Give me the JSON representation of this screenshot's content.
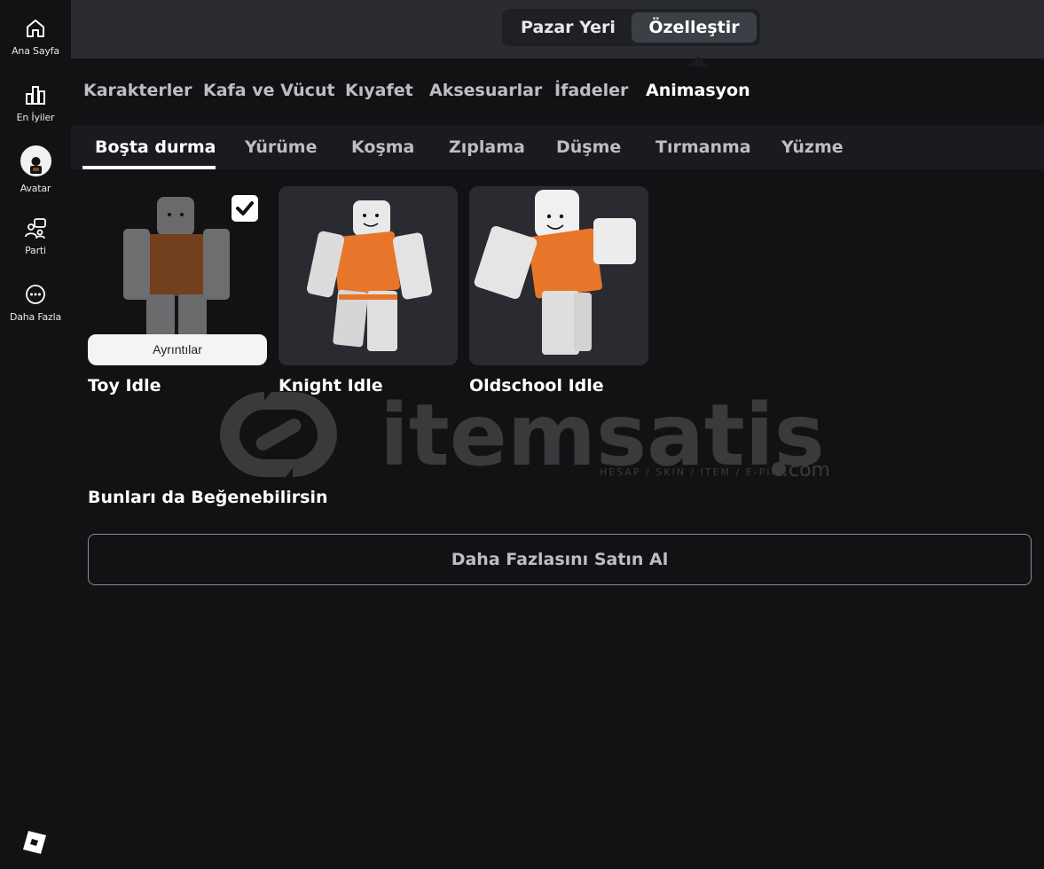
{
  "sidebar": {
    "items": [
      {
        "label": "Ana Sayfa",
        "icon": "home-icon"
      },
      {
        "label": "En İyiler",
        "icon": "chart-icon"
      },
      {
        "label": "Avatar",
        "icon": "avatar-icon"
      },
      {
        "label": "Parti",
        "icon": "party-icon"
      },
      {
        "label": "Daha Fazla",
        "icon": "more-icon"
      }
    ],
    "logo": "roblox-logo-icon"
  },
  "topbar": {
    "tabs": [
      {
        "label": "Pazar Yeri",
        "active": false
      },
      {
        "label": "Özelleştir",
        "active": true
      }
    ]
  },
  "categories": [
    {
      "label": "Karakterler",
      "active": false
    },
    {
      "label": "Kafa ve Vücut",
      "active": false
    },
    {
      "label": "Kıyafet",
      "active": false
    },
    {
      "label": "Aksesuarlar",
      "active": false
    },
    {
      "label": "İfadeler",
      "active": false
    },
    {
      "label": "Animasyon",
      "active": true
    }
  ],
  "subtabs": [
    {
      "label": "Boşta durma",
      "active": true
    },
    {
      "label": "Yürüme",
      "active": false
    },
    {
      "label": "Koşma",
      "active": false
    },
    {
      "label": "Zıplama",
      "active": false
    },
    {
      "label": "Düşme",
      "active": false
    },
    {
      "label": "Tırmanma",
      "active": false
    },
    {
      "label": "Yüzme",
      "active": false
    }
  ],
  "items": [
    {
      "name": "Toy Idle",
      "selected": true,
      "details_label": "Ayrıntılar"
    },
    {
      "name": "Knight Idle",
      "selected": false
    },
    {
      "name": "Oldschool Idle",
      "selected": false
    }
  ],
  "watermark": {
    "brand": "itemsatis",
    "tagline": "HESAP / SKIN / ITEM / E-PIN",
    "suffix": ".com"
  },
  "recommend": {
    "title": "Bunları da Beğenebilirsin",
    "buy_label": "Daha Fazlasını Satın Al"
  },
  "colors": {
    "accent_orange": "#e8762a",
    "background": "#121215",
    "topbar": "#2b2c31"
  }
}
